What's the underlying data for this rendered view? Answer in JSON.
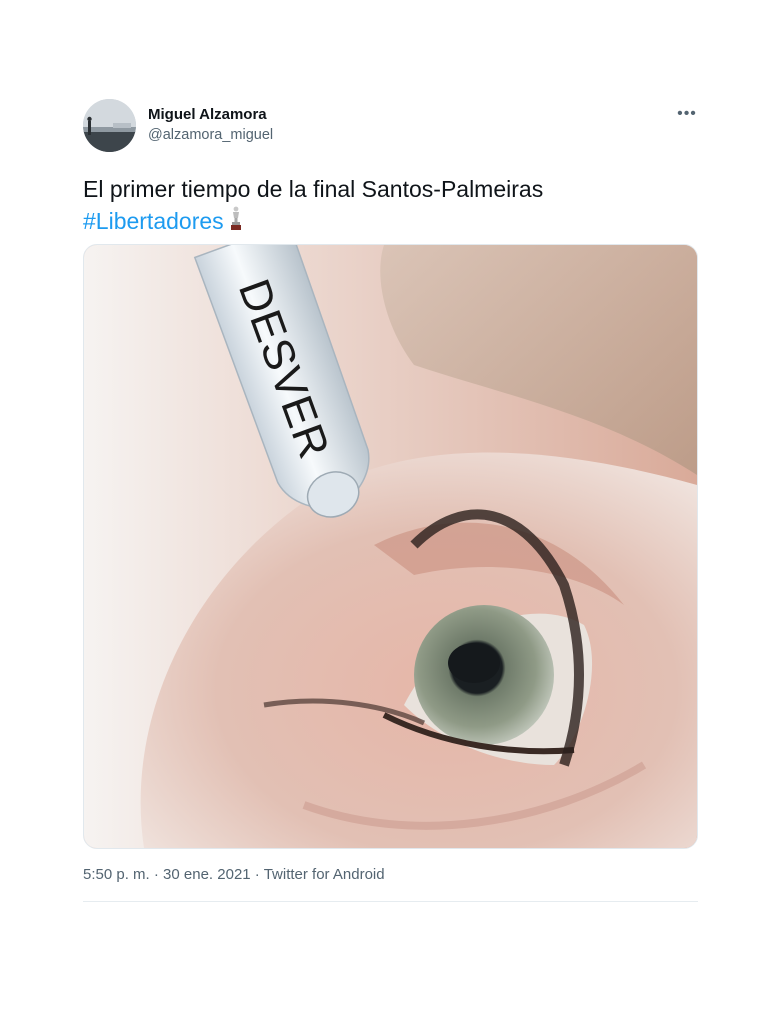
{
  "tweet": {
    "author": {
      "display_name": "Miguel Alzamora",
      "handle": "@alzamora_miguel",
      "avatar_icon": "avatar-photo"
    },
    "more_icon": "more-options-icon",
    "text": {
      "line1": "El primer tiempo de la final Santos-Palmeiras",
      "hashtag": "#Libertadores",
      "emoji_icon": "trophy-icon"
    },
    "media": {
      "dropper_label": "DESVER"
    },
    "meta": {
      "time": "5:50 p. m.",
      "separator": " · ",
      "date": "30 ene. 2021",
      "source": "Twitter for Android"
    }
  },
  "colors": {
    "text_primary": "#0f1419",
    "text_secondary": "#536471",
    "link": "#1d9bf0",
    "divider": "#e6ecf0"
  }
}
